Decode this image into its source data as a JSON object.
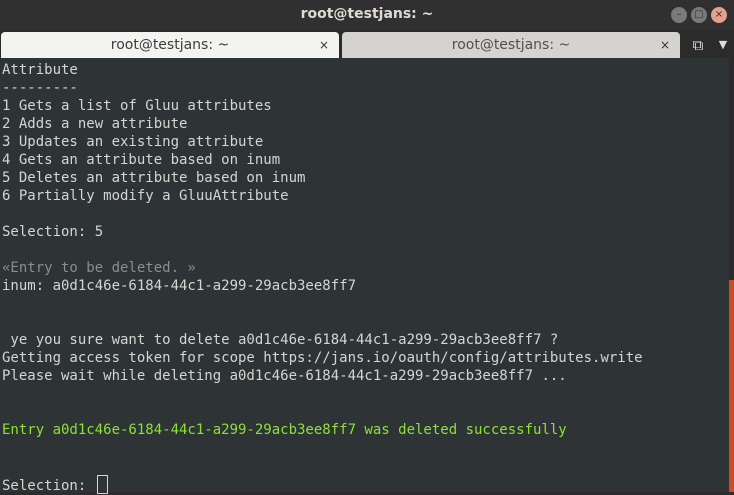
{
  "window": {
    "title": "root@testjans: ~"
  },
  "tabs": [
    {
      "label": "root@testjans: ~",
      "close": "×"
    },
    {
      "label": "root@testjans: ~",
      "close": "×"
    }
  ],
  "icons": {
    "minimize": "minimize-icon",
    "maximize": "maximize-icon",
    "close": "close-icon",
    "new_tab": "new-tab-icon",
    "menu": "chevron-down-icon"
  },
  "terminal": {
    "lines": [
      "Attribute",
      "---------",
      "1 Gets a list of Gluu attributes",
      "2 Adds a new attribute",
      "3 Updates an existing attribute",
      "4 Gets an attribute based on inum",
      "5 Deletes an attribute based on inum",
      "6 Partially modify a GluuAttribute",
      "",
      "Selection: 5",
      "",
      "«Entry to be deleted. »",
      "inum: a0d1c46e-6184-44c1-a299-29acb3ee8ff7",
      "",
      "",
      " ye you sure want to delete a0d1c46e-6184-44c1-a299-29acb3ee8ff7 ?",
      "Getting access token for scope https://jans.io/oauth/config/attributes.write",
      "Please wait while deleting a0d1c46e-6184-44c1-a299-29acb3ee8ff7 ...",
      "",
      "",
      "Entry a0d1c46e-6184-44c1-a299-29acb3ee8ff7 was deleted successfully",
      "",
      "",
      "Selection: "
    ]
  },
  "colors": {
    "terminal_bg": "#2e3436",
    "terminal_fg": "#d3d7cf",
    "success": "#8ae234",
    "hint": "#8a8f8a",
    "accent": "#e95420"
  }
}
